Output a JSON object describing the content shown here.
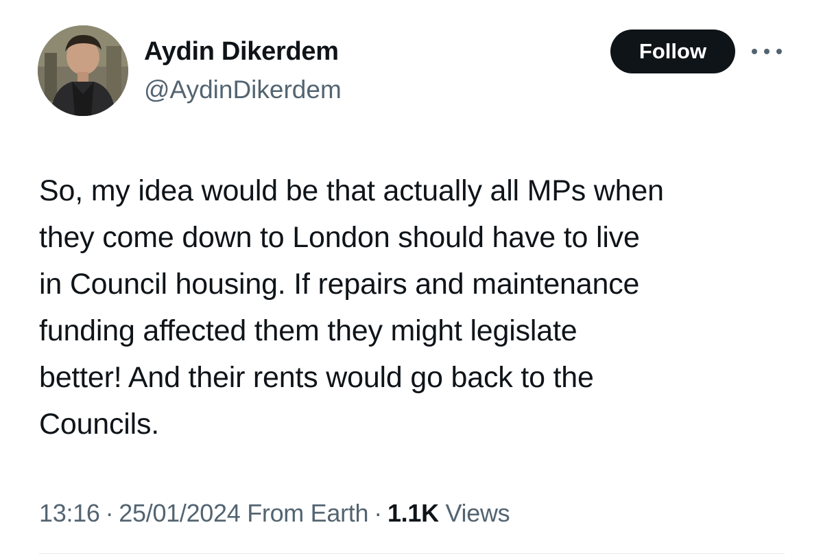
{
  "author": {
    "display_name": "Aydin Dikerdem",
    "handle": "@AydinDikerdem",
    "avatar_icon": "profile-photo"
  },
  "actions": {
    "follow_label": "Follow",
    "more_icon": "more-horizontal-icon"
  },
  "tweet": {
    "lines": [
      "So, my idea would be that actually all MPs when",
      "they come down to London should have to live",
      "in Council housing. If repairs and maintenance",
      "funding affected them they might legislate",
      "better! And their rents would go back to the",
      "Councils."
    ]
  },
  "meta": {
    "time": "13:16",
    "separator": "·",
    "date": "25/01/2024",
    "source": "From Earth",
    "views_count": "1.1K",
    "views_label": "Views"
  },
  "colors": {
    "text_primary": "#0f1419",
    "text_secondary": "#536471",
    "follow_bg": "#0f1419",
    "divider": "#e7e9ea"
  }
}
